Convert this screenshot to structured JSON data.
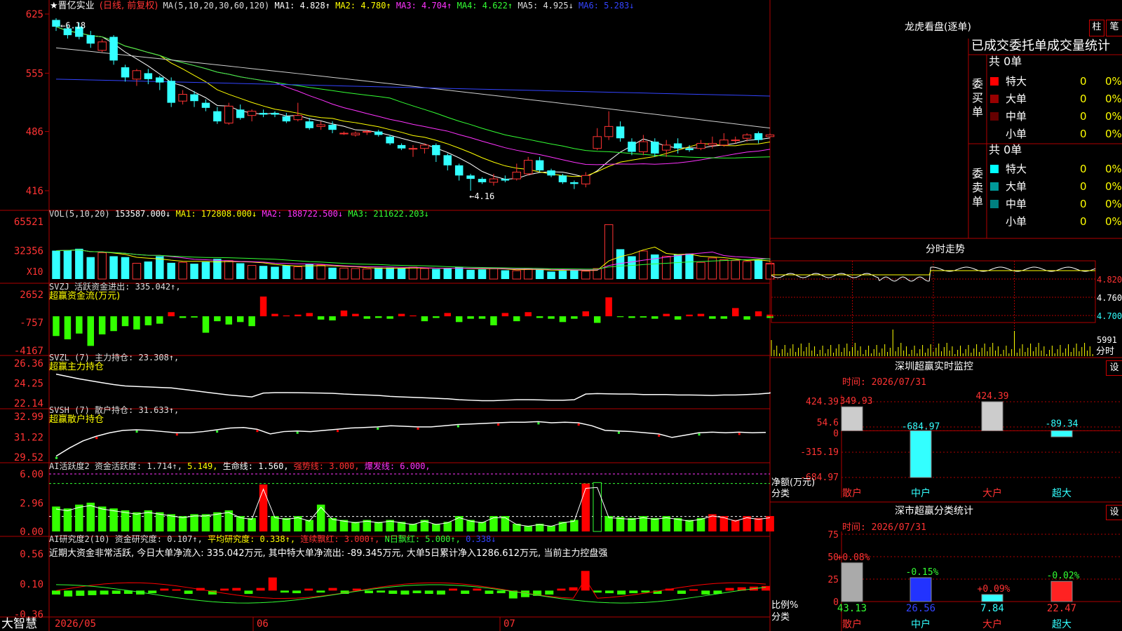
{
  "stock": {
    "name": "★晋亿实业",
    "period": "(日线, 前复权)",
    "ma_label": "MA(5,10,20,30,60,120)",
    "ma": [
      {
        "label": "MA1:",
        "value": "4.828↑",
        "color": "#ffffff"
      },
      {
        "label": "MA2:",
        "value": "4.780↑",
        "color": "#ffff00"
      },
      {
        "label": "MA3:",
        "value": "4.704↑",
        "color": "#ff33ff"
      },
      {
        "label": "MA4:",
        "value": "4.622↑",
        "color": "#33ff33"
      },
      {
        "label": "MA5:",
        "value": "4.925↓",
        "color": "#dddddd"
      },
      {
        "label": "MA6:",
        "value": "5.283↓",
        "color": "#3344ff"
      }
    ],
    "price_axis": [
      "625",
      "555",
      "486",
      "416"
    ],
    "high_mark": "6.18",
    "low_mark": "4.16"
  },
  "vol": {
    "label": "VOL(5,10,20)",
    "value": "153587.000↓",
    "ma1": "MA1: 172808.000↓",
    "ma2": "MA2: 188722.500↓",
    "ma3": "MA3: 211622.203↓",
    "axis": [
      "65521",
      "32356"
    ],
    "unit": "X10"
  },
  "svzj": {
    "label": "SVZJ  活跃资金进出: 335.042↑,",
    "sub": "超赢资金流(万元)",
    "axis": [
      "2652",
      "-757",
      "-4167"
    ]
  },
  "svzl": {
    "label": "SVZL (7) 主力持仓: 23.308↑,",
    "sub": "超赢主力持仓",
    "axis": [
      "26.36",
      "24.25",
      "22.14"
    ]
  },
  "svsh": {
    "label": "SVSH (7) 散户持仓: 31.633↑,",
    "sub": "超赢散户持仓",
    "axis": [
      "32.99",
      "31.22",
      "29.52"
    ]
  },
  "ai_active": {
    "label": "AI活跃度2 资金活跃度: 1.714↑,",
    "v2": "5.149,",
    "life": "生命线: 1.560,",
    "strong": "强势线: 3.000,",
    "burst": "爆发线: 6.000,",
    "axis": [
      "6.00",
      "2.96",
      "0.00"
    ]
  },
  "ai_research": {
    "label": "AI研究度2(10) 资金研究度: 0.107↑,",
    "avg": "平均研究度: 0.338↑,",
    "cont": "连续飘红: 3.000↑,",
    "nday": "N日飘红: 5.000↑,",
    "last": "0.338↓",
    "note": "近期大资金非常活跃, 今日大单净流入: 335.042万元, 其中特大单净流出: -89.345万元, 大单5日累计净入1286.612万元, 当前主力控盘强",
    "axis": [
      "0.56",
      "0.10",
      "-0.36"
    ]
  },
  "date_axis": [
    "2026/05",
    "06",
    "07"
  ],
  "brand": "大智慧",
  "right": {
    "title": "龙虎看盘(逐单)",
    "btn_zhu": "柱",
    "btn_bi": "笔",
    "stats_title": "已成交委托单成交量统计",
    "buy_label": "委买单",
    "sell_label": "委卖单",
    "buy_total": "共 0单",
    "sell_total": "共 0单",
    "buy_rows": [
      {
        "name": "特大",
        "n": "0",
        "pct": "0%",
        "color": "#ff0000"
      },
      {
        "name": "大单",
        "n": "0",
        "pct": "0%",
        "color": "#990000"
      },
      {
        "name": "中单",
        "n": "0",
        "pct": "0%",
        "color": "#660000"
      },
      {
        "name": "小单",
        "n": "0",
        "pct": "0%",
        "color": "#000000"
      }
    ],
    "sell_rows": [
      {
        "name": "特大",
        "n": "0",
        "pct": "0%",
        "color": "#00ffff"
      },
      {
        "name": "大单",
        "n": "0",
        "pct": "0%",
        "color": "#009999"
      },
      {
        "name": "中单",
        "n": "0",
        "pct": "0%",
        "color": "#008080"
      },
      {
        "name": "小单",
        "n": "0",
        "pct": "0%",
        "color": "#000000"
      }
    ],
    "intraday_title": "分时走势",
    "intraday_axis": [
      "4.820",
      "4.760",
      "4.700"
    ],
    "intraday_vol": "5991",
    "intraday_vol_unit": "分时",
    "sz_title": "深圳超赢实时监控",
    "sz_btn": "设",
    "sz_time": "时间: 2026/07/31",
    "sz_axis": [
      "424.39",
      "54.6",
      "0",
      "-315.19",
      "-684.97"
    ],
    "sz_ylabel": "净额(万元)",
    "sz_xlabel": "分类",
    "sz_cats": [
      "散户",
      "中户",
      "大户",
      "超大"
    ],
    "sz_vals_text": [
      "349.93",
      "-684.97",
      "424.39",
      "-89.34"
    ],
    "cls_title": "深市超赢分类统计",
    "cls_btn": "设",
    "cls_time": "时间: 2026/07/31",
    "cls_axis": [
      "75",
      "50",
      "25",
      "0"
    ],
    "cls_ylabel": "比例%",
    "cls_xlabel": "分类",
    "cls_cats": [
      "散户",
      "中户",
      "大户",
      "超大"
    ],
    "cls_vals_text": [
      "43.13",
      "26.56",
      "7.84",
      "22.47"
    ],
    "cls_change": [
      "+0.08%",
      "-0.15%",
      "+0.09%",
      "-0.02%"
    ]
  },
  "chart_data": [
    {
      "type": "candlestick",
      "title": "晋亿实业 (日线, 前复权)",
      "x": [
        "2026/05",
        "06",
        "07"
      ],
      "ylim": [
        4.16,
        6.25
      ],
      "high": 6.18,
      "low": 4.16,
      "ohlc": [
        [
          6.18,
          6.1,
          6.2,
          6.05
        ],
        [
          6.08,
          6.0,
          6.12,
          5.96
        ],
        [
          6.1,
          5.98,
          6.15,
          5.95
        ],
        [
          6.0,
          5.9,
          6.05,
          5.85
        ],
        [
          5.82,
          5.92,
          5.95,
          5.8
        ],
        [
          5.98,
          5.7,
          6.0,
          5.65
        ],
        [
          5.62,
          5.5,
          5.65,
          5.45
        ],
        [
          5.48,
          5.58,
          5.6,
          5.4
        ],
        [
          5.55,
          5.48,
          5.6,
          5.42
        ],
        [
          5.5,
          5.44,
          5.52,
          5.35
        ],
        [
          5.46,
          5.2,
          5.5,
          5.15
        ],
        [
          5.22,
          5.3,
          5.35,
          5.18
        ],
        [
          5.3,
          5.22,
          5.34,
          5.15
        ],
        [
          5.2,
          5.14,
          5.24,
          5.1
        ],
        [
          5.1,
          4.98,
          5.15,
          4.95
        ],
        [
          4.96,
          5.16,
          5.2,
          4.94
        ],
        [
          5.12,
          5.02,
          5.18,
          5.0
        ],
        [
          5.05,
          5.1,
          5.12,
          4.98
        ],
        [
          5.08,
          5.06,
          5.12,
          5.03
        ],
        [
          5.08,
          5.06,
          5.1,
          5.03
        ],
        [
          5.04,
          4.98,
          5.08,
          4.96
        ],
        [
          5.0,
          5.05,
          5.2,
          4.98
        ],
        [
          4.98,
          4.9,
          5.02,
          4.88
        ],
        [
          4.92,
          4.94,
          4.98,
          4.88
        ],
        [
          4.94,
          4.88,
          4.98,
          4.84
        ],
        [
          4.84,
          4.84,
          4.86,
          4.82
        ],
        [
          4.82,
          4.84,
          4.86,
          4.8
        ],
        [
          4.86,
          4.86,
          4.88,
          4.82
        ],
        [
          4.86,
          4.82,
          4.88,
          4.8
        ],
        [
          4.8,
          4.72,
          4.82,
          4.7
        ],
        [
          4.7,
          4.66,
          4.72,
          4.64
        ],
        [
          4.66,
          4.66,
          4.7,
          4.56
        ],
        [
          4.66,
          4.7,
          4.72,
          4.6
        ],
        [
          4.7,
          4.58,
          4.72,
          4.5
        ],
        [
          4.58,
          4.46,
          4.6,
          4.4
        ],
        [
          4.46,
          4.34,
          4.48,
          4.28
        ],
        [
          4.34,
          4.3,
          4.36,
          4.16
        ],
        [
          4.3,
          4.26,
          4.32,
          4.24
        ],
        [
          4.26,
          4.3,
          4.36,
          4.22
        ],
        [
          4.3,
          4.28,
          4.34,
          4.26
        ],
        [
          4.3,
          4.38,
          4.48,
          4.28
        ],
        [
          4.36,
          4.52,
          4.56,
          4.34
        ],
        [
          4.52,
          4.4,
          4.56,
          4.38
        ],
        [
          4.4,
          4.34,
          4.42,
          4.32
        ],
        [
          4.34,
          4.26,
          4.36,
          4.24
        ],
        [
          4.26,
          4.24,
          4.28,
          4.18
        ],
        [
          4.24,
          4.34,
          4.38,
          4.2
        ],
        [
          4.66,
          4.8,
          4.9,
          4.64
        ],
        [
          4.8,
          4.92,
          5.1,
          4.76
        ],
        [
          4.92,
          4.78,
          4.98,
          4.74
        ],
        [
          4.74,
          4.62,
          4.78,
          4.58
        ],
        [
          4.62,
          4.74,
          4.82,
          4.58
        ],
        [
          4.74,
          4.6,
          4.78,
          4.56
        ],
        [
          4.64,
          4.7,
          4.76,
          4.56
        ],
        [
          4.72,
          4.66,
          4.78,
          4.6
        ],
        [
          4.66,
          4.64,
          4.7,
          4.62
        ],
        [
          4.66,
          4.72,
          4.76,
          4.64
        ],
        [
          4.7,
          4.72,
          4.8,
          4.66
        ],
        [
          4.7,
          4.76,
          4.84,
          4.68
        ],
        [
          4.76,
          4.76,
          4.8,
          4.72
        ],
        [
          4.78,
          4.82,
          4.84,
          4.74
        ],
        [
          4.84,
          4.76,
          4.86,
          4.72
        ],
        [
          4.8,
          4.82,
          4.84,
          4.78
        ]
      ]
    },
    {
      "type": "bar",
      "title": "VOL(5,10,20)",
      "ylim": [
        0,
        65521
      ],
      "values": [
        32356,
        33000,
        34500,
        25000,
        30000,
        26000,
        25000,
        18000,
        20000,
        26000,
        18500,
        19000,
        17500,
        19500,
        23000,
        21000,
        18000,
        15500,
        15000,
        14000,
        15500,
        14000,
        17000,
        16000,
        13000,
        12500,
        12000,
        11500,
        13000,
        13000,
        12000,
        13500,
        12000,
        11500,
        12000,
        14000,
        10500,
        11000,
        12000,
        10000,
        9500,
        12000,
        11000,
        8500,
        9500,
        10500,
        9000,
        12000,
        62000,
        34000,
        26000,
        32000,
        28000,
        26000,
        28000,
        29000,
        19000,
        24000,
        22000,
        21000,
        20000,
        22000,
        18000,
        17000
      ]
    },
    {
      "type": "bar",
      "title": "超赢资金流(万元)",
      "ylim": [
        -4167,
        2652
      ],
      "values": [
        -2400,
        -2800,
        -2100,
        -3600,
        -2200,
        -1800,
        -1200,
        -1600,
        -1100,
        -900,
        500,
        -200,
        -150,
        -2000,
        -600,
        -1000,
        -700,
        -1200,
        2400,
        300,
        100,
        200,
        400,
        -400,
        -500,
        700,
        300,
        -300,
        -200,
        -300,
        300,
        100,
        -600,
        -200,
        400,
        -700,
        -300,
        -300,
        -1100,
        400,
        -600,
        500,
        -200,
        -300,
        -700,
        -300,
        600,
        -800,
        2300,
        -100,
        -200,
        -150,
        -300,
        300,
        -400,
        200,
        300,
        -300,
        -300,
        1000,
        -400,
        600,
        -200,
        200
      ]
    },
    {
      "type": "line",
      "title": "超赢主力持仓",
      "ylim": [
        22.14,
        26.36
      ],
      "y": [
        25.2,
        24.95,
        24.7,
        24.5,
        24.3,
        24.1,
        23.95,
        23.9,
        23.85,
        23.8,
        23.75,
        23.6,
        23.45,
        23.3,
        23.15,
        23.0,
        22.9,
        22.8,
        23.2,
        23.25,
        23.25,
        23.24,
        23.22,
        23.2,
        23.18,
        23.1,
        23.05,
        23.0,
        22.95,
        22.85,
        22.8,
        22.75,
        22.7,
        22.65,
        22.6,
        22.5,
        22.45,
        22.4,
        22.4,
        22.45,
        22.5,
        22.5,
        22.48,
        22.45,
        22.45,
        22.5,
        23.1,
        23.15,
        23.12,
        23.1,
        23.1,
        23.05,
        23.05,
        23.05,
        23.0,
        23.0,
        22.98,
        22.95,
        23.0,
        23.0,
        23.05,
        23.1,
        23.2,
        23.3
      ]
    },
    {
      "type": "line",
      "title": "超赢散户持仓",
      "ylim": [
        29.52,
        32.99
      ],
      "y": [
        29.6,
        30.3,
        30.9,
        31.3,
        31.6,
        31.8,
        31.85,
        31.8,
        31.7,
        31.6,
        31.6,
        31.7,
        31.85,
        32.0,
        32.05,
        31.9,
        31.5,
        31.7,
        31.75,
        31.7,
        31.8,
        31.9,
        32.0,
        32.05,
        32.1,
        32.2,
        32.15,
        32.1,
        32.1,
        32.2,
        32.3,
        32.35,
        32.4,
        32.45,
        32.5,
        32.5,
        32.55,
        32.45,
        32.5,
        32.45,
        32.2,
        31.8,
        31.75,
        31.7,
        31.6,
        31.5,
        31.2,
        31.4,
        31.6,
        31.65,
        31.6,
        31.65,
        31.6,
        31.63
      ]
    },
    {
      "type": "bar",
      "title": "AI活跃度2",
      "ylim": [
        0,
        6
      ],
      "values": [
        2.6,
        2.4,
        2.8,
        3.0,
        2.6,
        2.4,
        2.2,
        2.0,
        2.2,
        2.0,
        1.8,
        1.6,
        1.8,
        1.8,
        2.0,
        2.2,
        1.6,
        1.4,
        4.9,
        1.6,
        1.4,
        1.6,
        1.2,
        2.8,
        1.4,
        1.2,
        1.0,
        1.2,
        1.0,
        1.2,
        1.0,
        0.8,
        1.2,
        0.8,
        1.0,
        1.6,
        1.2,
        1.0,
        1.6,
        1.6,
        0.8,
        0.6,
        0.8,
        0.6,
        1.0,
        1.2,
        5.0,
        5.1,
        1.6,
        1.5,
        1.4,
        1.6,
        1.4,
        1.6,
        1.4,
        1.2,
        1.4,
        1.8,
        1.6,
        1.2,
        1.6,
        1.4,
        1.6,
        1.6
      ],
      "lines": {
        "strong": 3.0,
        "burst": 6.0,
        "life": 1.56
      }
    },
    {
      "type": "bar",
      "title": "AI研究度2(10)",
      "ylim": [
        -0.36,
        0.56
      ],
      "values": [
        -0.06,
        -0.09,
        -0.08,
        -0.07,
        -0.06,
        -0.05,
        -0.05,
        -0.06,
        -0.04,
        0.03,
        0.02,
        -0.05,
        0.04,
        -0.06,
        0.03,
        0.04,
        -0.05,
        0.04,
        0.2,
        -0.03,
        -0.04,
        0.03,
        -0.03,
        0.04,
        -0.05,
        0.03,
        -0.04,
        -0.03,
        -0.05,
        -0.06,
        -0.04,
        -0.05,
        -0.06,
        0.03,
        -0.05,
        0.03,
        -0.05,
        -0.04,
        -0.12,
        -0.1,
        -0.08,
        -0.06,
        0.03,
        0.05,
        0.3,
        -0.03,
        -0.04,
        -0.06,
        -0.04,
        -0.03,
        -0.05,
        0.03,
        -0.05,
        0.02,
        -0.06,
        -0.05,
        0.04,
        0.05,
        0.06,
        0.07
      ]
    },
    {
      "type": "bar",
      "title": "深圳超赢实时监控",
      "ylabel": "净额(万元)",
      "categories": [
        "散户",
        "中户",
        "大户",
        "超大"
      ],
      "values": [
        349.93,
        -684.97,
        424.39,
        -89.34
      ],
      "ylim": [
        -684.97,
        424.39
      ]
    },
    {
      "type": "bar",
      "title": "深市超赢分类统计",
      "ylabel": "比例%",
      "categories": [
        "散户",
        "中户",
        "大户",
        "超大"
      ],
      "values": [
        43.13,
        26.56,
        7.84,
        22.47
      ],
      "ylim": [
        0,
        75
      ]
    }
  ]
}
